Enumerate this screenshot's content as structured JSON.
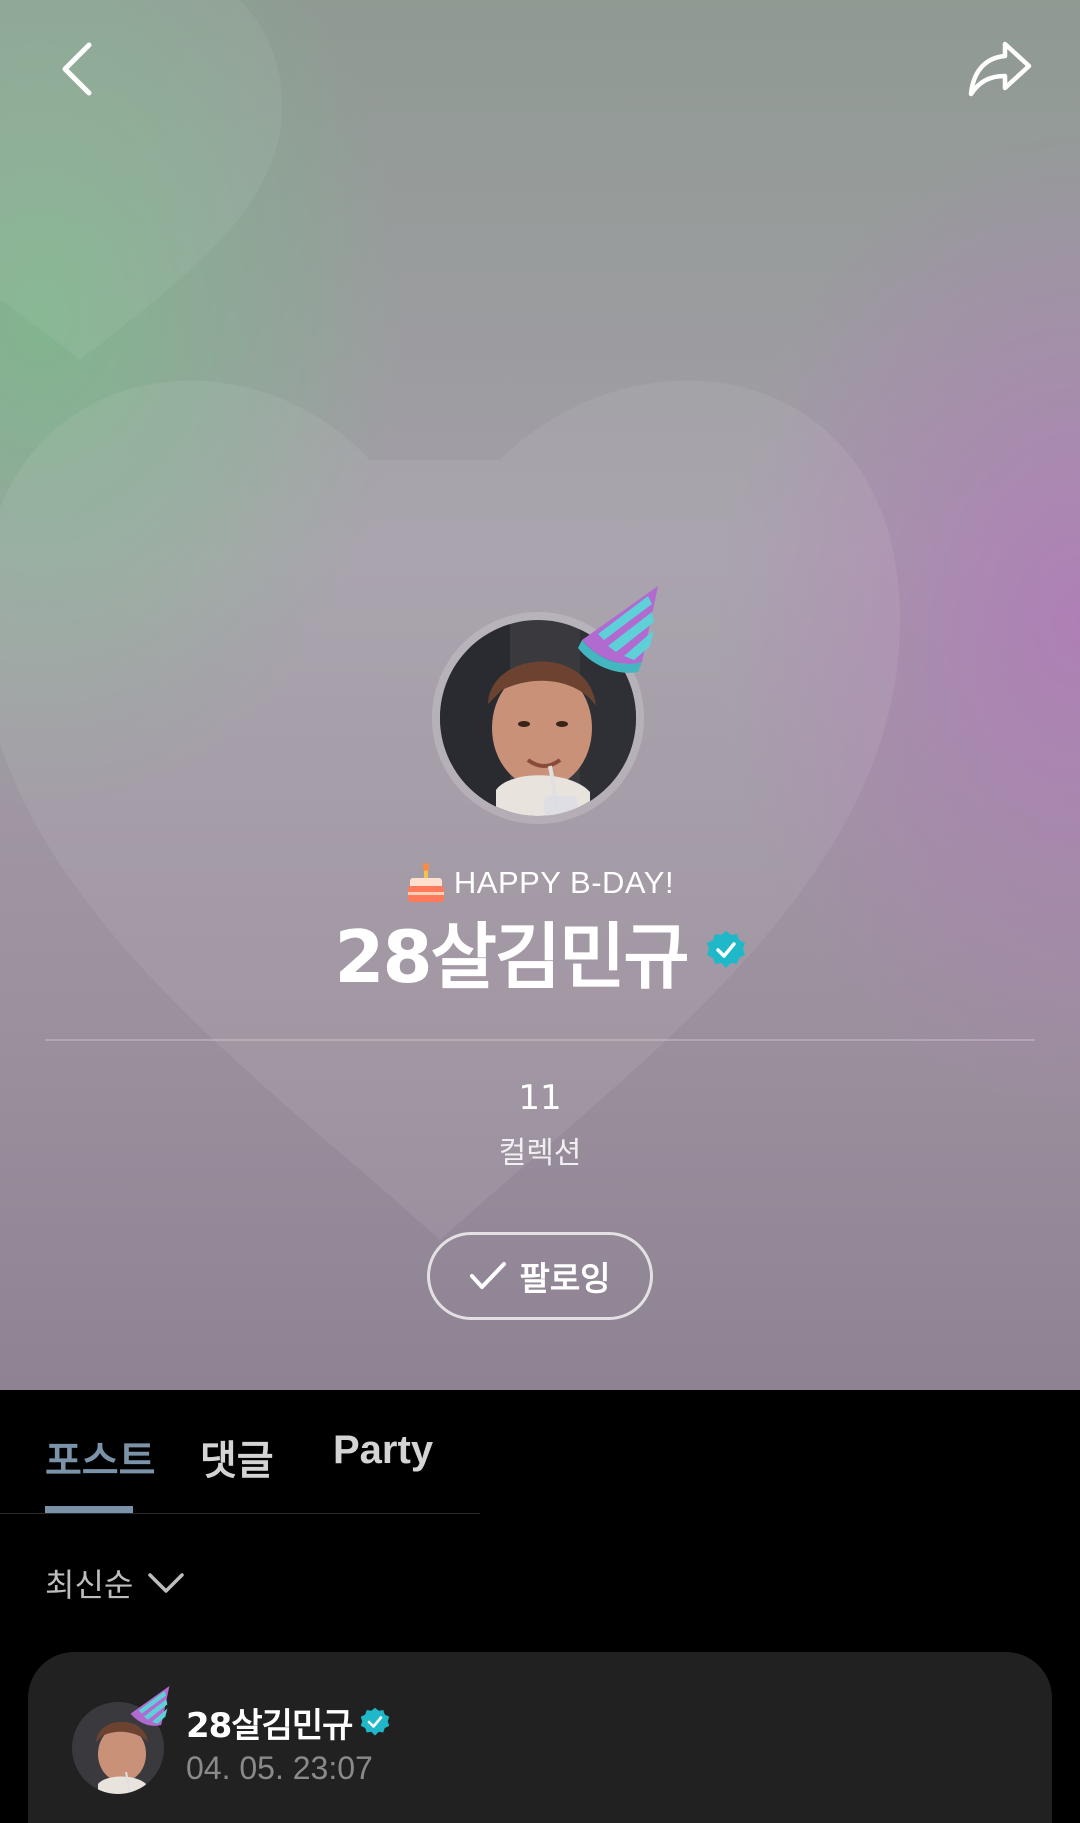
{
  "header": {
    "back_icon": "chevron-left-icon",
    "share_icon": "share-arrow-icon"
  },
  "profile": {
    "badge_text": "HAPPY B-DAY!",
    "name": "28살김민규",
    "verified": true,
    "collections_count": "11",
    "collections_label": "컬렉션",
    "follow_label": "팔로잉"
  },
  "tabs": [
    {
      "label": "포스트",
      "active": true
    },
    {
      "label": "댓글",
      "active": false
    },
    {
      "label": "Party",
      "active": false
    }
  ],
  "sort": {
    "label": "최신순"
  },
  "post": {
    "author": "28살김민규",
    "timestamp": "04. 05. 23:07"
  },
  "colors": {
    "accent_tab": "#7a93a8",
    "verified_badge": "#1fb8c9",
    "card_bg": "#212121"
  }
}
